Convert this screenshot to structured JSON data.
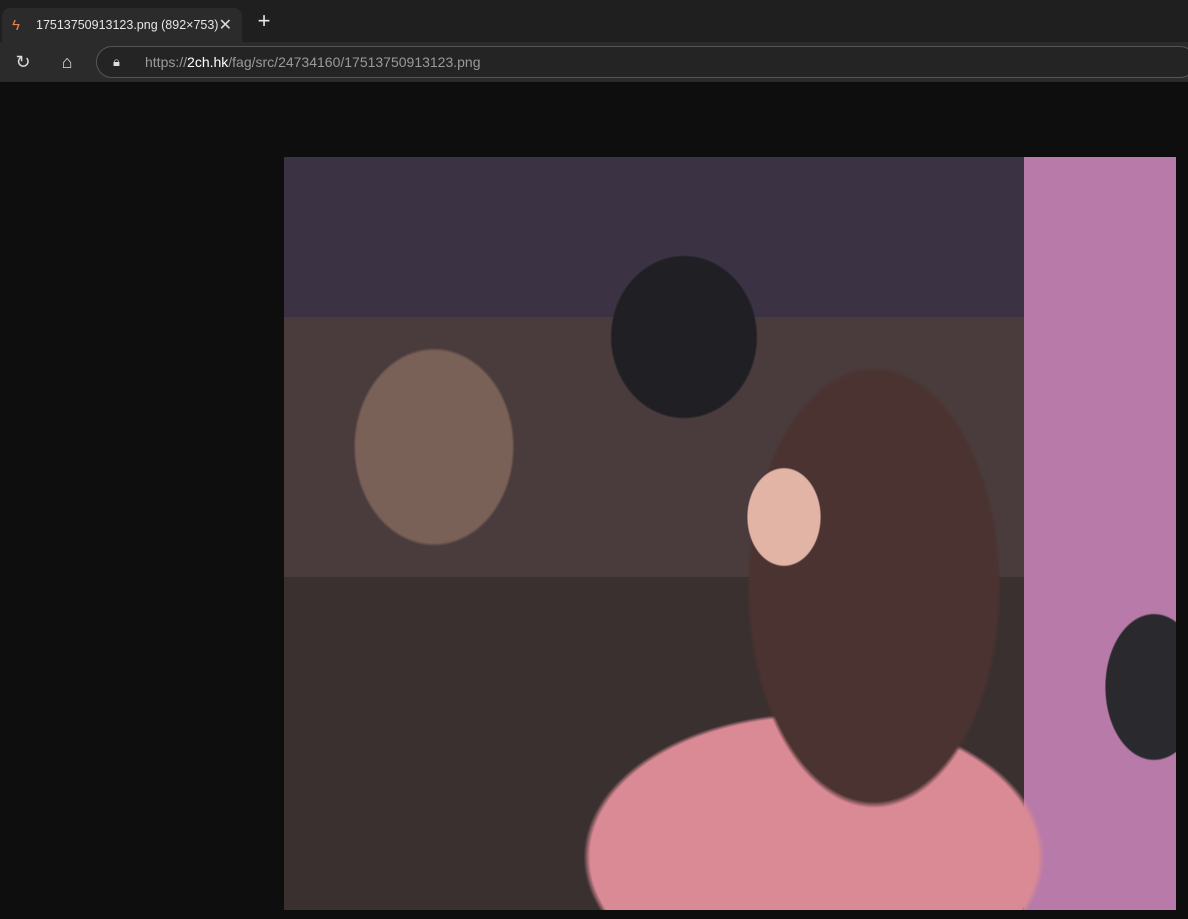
{
  "tab": {
    "title": "17513750913123.png (892×753)",
    "icon": "bolt-icon"
  },
  "toolbar": {
    "url_scheme": "https://",
    "url_host": "2ch.hk",
    "url_path": "/fag/src/24734160/17513750913123.png"
  },
  "image": {
    "alt": "17513750913123.png"
  }
}
